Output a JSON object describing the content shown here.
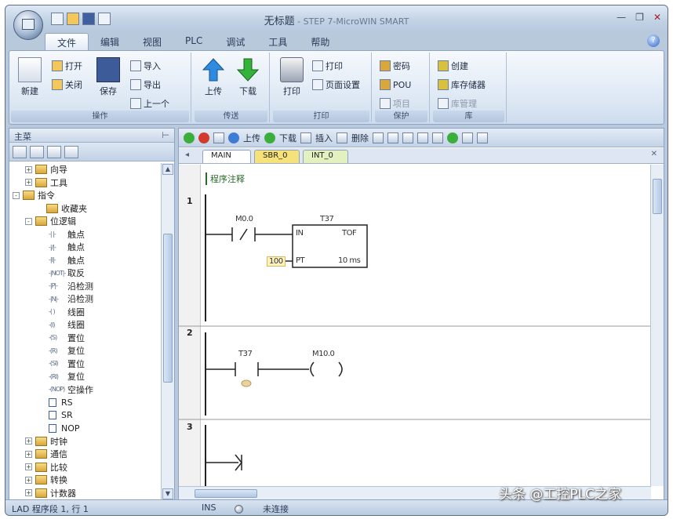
{
  "window": {
    "title": "无标题",
    "subtitle": " - STEP 7-MicroWIN SMART"
  },
  "ribbon": {
    "tabs": [
      "文件",
      "编辑",
      "视图",
      "PLC",
      "调试",
      "工具",
      "帮助"
    ],
    "file_group": {
      "new": "新建",
      "open": "打开",
      "close": "关闭",
      "save": "保存",
      "import": "导入",
      "export": "导出",
      "previous": "上一个",
      "label": "操作"
    },
    "transfer_group": {
      "upload": "上传",
      "download": "下载",
      "label": "传送"
    },
    "print_group": {
      "print": "打印",
      "page_setup": "页面设置",
      "label": "打印"
    },
    "protect_group": {
      "password": "密码",
      "pou": "POU",
      "project": "项目",
      "label": "保护"
    },
    "library_group": {
      "create": "创建",
      "memory": "库存储器",
      "manage": "库管理",
      "label": "库"
    }
  },
  "left_panel": {
    "title": "主菜",
    "tree": [
      {
        "type": "folder",
        "expand": "+",
        "label": "向导",
        "indent": 20
      },
      {
        "type": "folder",
        "expand": "+",
        "label": "工具",
        "indent": 20
      },
      {
        "type": "folder",
        "expand": "-",
        "label": "指令",
        "indent": 4
      },
      {
        "type": "folder",
        "expand": "",
        "label": "收藏夹",
        "indent": 34
      },
      {
        "type": "folder",
        "expand": "-",
        "label": "位逻辑",
        "indent": 20
      },
      {
        "type": "instr",
        "code": "-| |-",
        "label": "触点",
        "indent": 50
      },
      {
        "type": "instr",
        "code": "-|/|-",
        "label": "触点",
        "indent": 50
      },
      {
        "type": "instr",
        "code": "-|I|-",
        "label": "触点",
        "indent": 50
      },
      {
        "type": "instr",
        "code": "-|NOT|-",
        "label": "取反",
        "indent": 50
      },
      {
        "type": "instr",
        "code": "-|P|-",
        "label": "沿检测",
        "indent": 50
      },
      {
        "type": "instr",
        "code": "-|N|-",
        "label": "沿检测",
        "indent": 50
      },
      {
        "type": "instr",
        "code": "-( )",
        "label": "线圈",
        "indent": 50
      },
      {
        "type": "instr",
        "code": "-(I)",
        "label": "线圈",
        "indent": 50
      },
      {
        "type": "instr",
        "code": "-(S)",
        "label": "置位",
        "indent": 50
      },
      {
        "type": "instr",
        "code": "-(R)",
        "label": "复位",
        "indent": 50
      },
      {
        "type": "instr",
        "code": "-(SI)",
        "label": "置位",
        "indent": 50
      },
      {
        "type": "instr",
        "code": "-(RI)",
        "label": "复位",
        "indent": 50
      },
      {
        "type": "instr",
        "code": "-(NOP)",
        "label": "空操作",
        "indent": 50
      },
      {
        "type": "box",
        "label": "RS",
        "indent": 50
      },
      {
        "type": "box",
        "label": "SR",
        "indent": 50
      },
      {
        "type": "box",
        "label": "NOP",
        "indent": 50
      },
      {
        "type": "folder",
        "expand": "+",
        "label": "时钟",
        "indent": 20
      },
      {
        "type": "folder",
        "expand": "+",
        "label": "通信",
        "indent": 20
      },
      {
        "type": "folder",
        "expand": "+",
        "label": "比较",
        "indent": 20
      },
      {
        "type": "folder",
        "expand": "+",
        "label": "转换",
        "indent": 20
      },
      {
        "type": "folder",
        "expand": "+",
        "label": "计数器",
        "indent": 20
      }
    ]
  },
  "editor": {
    "toolbar": {
      "upload": "上传",
      "download": "下载",
      "insert": "插入",
      "delete": "删除"
    },
    "tabs": [
      "MAIN",
      "SBR_0",
      "INT_0"
    ],
    "comment": "程序注释",
    "networks": [
      {
        "number": "1",
        "contact": "M0.0",
        "timer": "T37",
        "box_in": "IN",
        "box_type": "TOF",
        "pt_value": "100",
        "pt_label": "PT",
        "base": "10 ms"
      },
      {
        "number": "2",
        "contact": "T37",
        "coil": "M10.0"
      },
      {
        "number": "3"
      }
    ]
  },
  "status": {
    "left": "LAD 程序段 1, 行 1",
    "mid": "INS",
    "conn": "未连接"
  },
  "watermark": "头条 @工控PLC之家"
}
